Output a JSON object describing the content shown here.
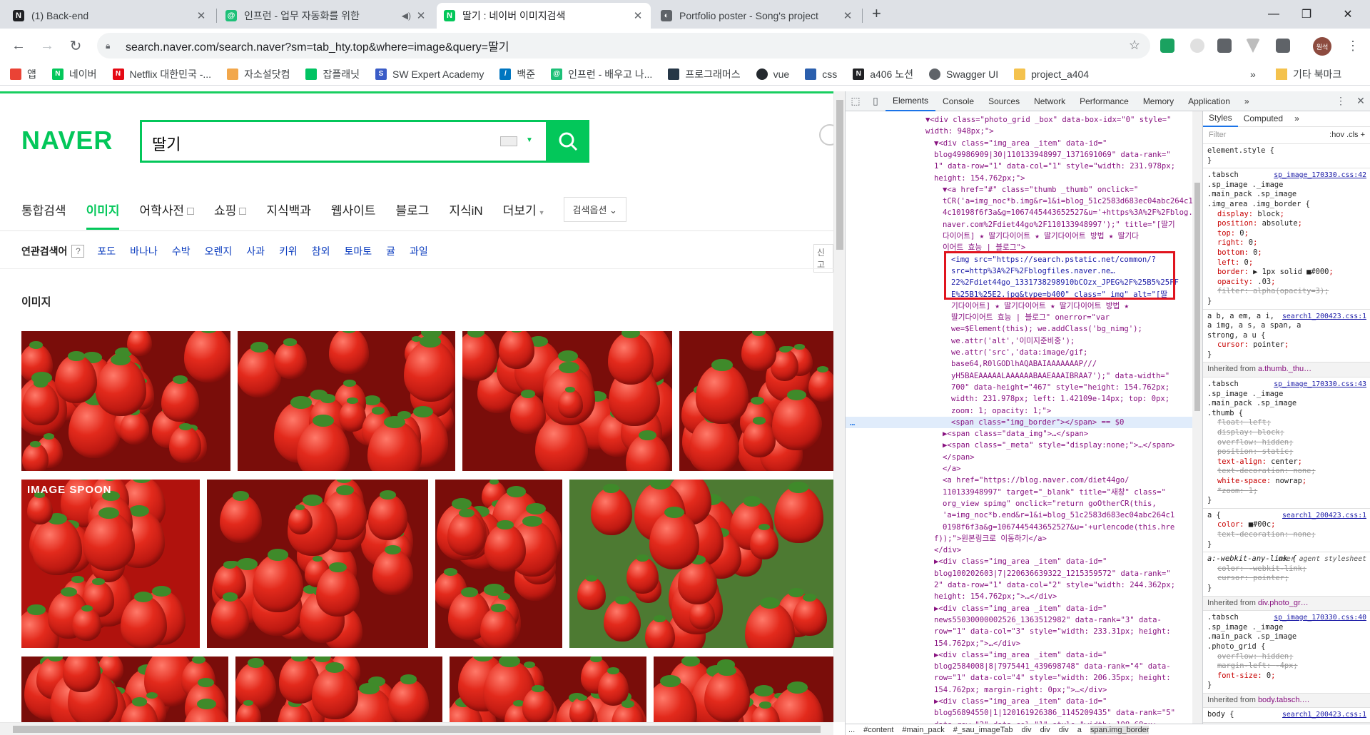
{
  "browser": {
    "tabs": [
      {
        "title": "(1) Back-end",
        "favicon_color": "#202124",
        "favicon_letter": "N"
      },
      {
        "title": "인프런 - 업무 자동화를 위한",
        "favicon_color": "#1dc078",
        "favicon_letter": "@"
      },
      {
        "title": "딸기 : 네이버 이미지검색",
        "favicon_color": "#03c75a",
        "favicon_letter": "N"
      },
      {
        "title": "Portfolio poster - Song's project",
        "favicon_color": "#5f6368",
        "favicon_letter": "◐"
      }
    ],
    "new_tab": "+",
    "window_controls": {
      "minimize": "—",
      "maximize": "❐",
      "close": "✕"
    },
    "url": "search.naver.com/search.naver?sm=tab_hty.top&where=image&query=딸기",
    "profile_label": "원석",
    "bookmarks": [
      {
        "label": "앱",
        "color": "#ea4335"
      },
      {
        "label": "네이버",
        "color": "#03c75a"
      },
      {
        "label": "Netflix 대한민국 -...",
        "color": "#e50914"
      },
      {
        "label": "자소설닷컴",
        "color": "#f2a74b"
      },
      {
        "label": "잡플래닛",
        "color": "#00c362"
      },
      {
        "label": "SW Expert Academy",
        "color": "#3a5cc7"
      },
      {
        "label": "백준",
        "color": "#0076c0"
      },
      {
        "label": "인프런 - 배우고 나...",
        "color": "#1dc078"
      },
      {
        "label": "프로그래머스",
        "color": "#263747"
      },
      {
        "label": "vue",
        "color": "#24292e"
      },
      {
        "label": "css",
        "color": "#2b5fad"
      },
      {
        "label": "a406 노션",
        "color": "#202124"
      },
      {
        "label": "Swagger UI",
        "color": "#5f6368"
      },
      {
        "label": "project_a404",
        "color": "#f4c24d"
      }
    ],
    "bookmarks_more": "»",
    "other_bookmarks": "기타 북마크"
  },
  "naver": {
    "logo": "NAVER",
    "query": "딸기",
    "tabs": [
      {
        "label": "통합검색",
        "active": false,
        "box": false
      },
      {
        "label": "이미지",
        "active": true,
        "box": false
      },
      {
        "label": "어학사전",
        "active": false,
        "box": true
      },
      {
        "label": "쇼핑",
        "active": false,
        "box": true
      },
      {
        "label": "지식백과",
        "active": false,
        "box": false
      },
      {
        "label": "웹사이트",
        "active": false,
        "box": false
      },
      {
        "label": "블로그",
        "active": false,
        "box": false
      },
      {
        "label": "지식iN",
        "active": false,
        "box": false
      },
      {
        "label": "더보기",
        "active": false,
        "box": false
      }
    ],
    "search_options": "검색옵션",
    "related_label": "연관검색어",
    "related_help": "?",
    "related_keywords": [
      "포도",
      "바나나",
      "수박",
      "오렌지",
      "사과",
      "키위",
      "참외",
      "토마토",
      "귤",
      "과일"
    ],
    "report": "신고",
    "image_section_title": "이미지",
    "thumb_label_spoon": "IMAGE SPOON"
  },
  "devtools": {
    "tabs": [
      "Elements",
      "Console",
      "Sources",
      "Network",
      "Performance",
      "Memory",
      "Application"
    ],
    "more": "»",
    "styles_tabs": [
      "Styles",
      "Computed"
    ],
    "filter_placeholder": "Filter",
    "hov": ":hov .cls +",
    "breadcrumb": [
      "...",
      "#content",
      "#main_pack",
      "#_sau_imageTab",
      "div",
      "div",
      "div",
      "a",
      "span.img_border"
    ],
    "dom_lines": [
      "▼<div class=\"photo_grid _box\" data-box-idx=\"0\" style=\"",
      "width: 948px;\">",
      "▼<div class=\"img_area _item\" data-id=\"",
      "blog49986909|30|110133948997_1371691069\" data-rank=\"",
      "1\" data-row=\"1\" data-col=\"1\" style=\"width: 231.978px;",
      "height: 154.762px;\">",
      "▼<a href=\"#\" class=\"thumb _thumb\" onclick=\"",
      "tCR('a=img_noc*b.img&r=1&i=blog_51c2583d683ec04abc264c1",
      "4c10198f6f3a&g=1067445443652527&u='+https%3A%2F%2Fblog.",
      "naver.com%2Fdiet44go%2F110133948997');\" title=\"[딸기",
      "다이어트] ★ 딸기다이어트 ★ 딸기다이어트 방법 ★ 딸기다",
      "이어트 효능 | 블로그\">",
      "<img src=\"https://search.pstatic.net/common/?",
      "src=http%3A%2F%2Fblogfiles.naver.ne…",
      "22%2Fdiet44go_1331738298910bCOzx_JPEG%2F%25B5%25FF",
      "E%25B1%25E2.jpg&type=b400\" class=\"_img\" alt=\"[딸",
      "기다이어트] ★ 딸기다이어트 ★ 딸기다이어트 방법 ★",
      "딸기다이어트 효능 | 블로그\" onerror=\"var",
      "we=$Element(this); we.addClass('bg_nimg');",
      "we.attr('alt','이미지준비중');",
      "we.attr('src','data:image/gif;",
      "base64,R0lGODlhAQABAIAAAAAAAP///",
      "yH5BAEAAAAALAAAAAABAAEAAAIBRAA7');\" data-width=\"",
      "700\" data-height=\"467\" style=\"height: 154.762px;",
      "width: 231.978px; left: 1.42109e-14px; top: 0px;",
      "zoom: 1; opacity: 1;\">",
      "<span class=\"img_border\"></span> == $0",
      "▶<span class=\"data_img\">…</span>",
      "▶<span class=\"_meta\" style=\"display:none;\">…</span>",
      "</span>",
      "</a>",
      "<a href=\"https://blog.naver.com/diet44go/",
      "110133948997\" target=\"_blank\" title=\"새창\" class=\"",
      "org_view spimg\" onclick=\"return goOtherCR(this,",
      "'a=img_noc*b.end&r=1&i=blog_51c2583d683ec04abc264c1",
      "0198f6f3a&g=1067445443652527&u='+urlencode(this.hre",
      "f));\">원본링크로 이동하기</a>",
      "</div>",
      "▶<div class=\"img_area _item\" data-id=\"",
      "blog100202603|7|220636639322_1215359572\" data-rank=\"",
      "2\" data-row=\"1\" data-col=\"2\" style=\"width: 244.362px;",
      "height: 154.762px;\">…</div>",
      "▶<div class=\"img_area _item\" data-id=\"",
      "news55030000002526_1363512982\" data-rank=\"3\" data-",
      "row=\"1\" data-col=\"3\" style=\"width: 233.31px; height:",
      "154.762px;\">…</div>",
      "▶<div class=\"img_area _item\" data-id=\"",
      "blog2584008|8|7975441_439698748\" data-rank=\"4\" data-",
      "row=\"1\" data-col=\"4\" style=\"width: 206.35px; height:",
      "154.762px; margin-right: 0px;\">…</div>",
      "▶<div class=\"img_area _item\" data-id=\"",
      "blog56894550|1|120161926386_1145209435\" data-rank=\"5\"",
      "data-row=\"2\" data-col=\"1\" style=\"width: 198.68px;"
    ],
    "styles": {
      "element_style": "element.style {",
      "rule1_selector": ".tabsch .sp_image ._image .main_pack .sp_image .img_area .img_border {",
      "rule1_source": "sp_image_170330.css:42",
      "rule1_props": [
        [
          "display",
          "block"
        ],
        [
          "position",
          "absolute"
        ],
        [
          "top",
          "0"
        ],
        [
          "right",
          "0"
        ],
        [
          "bottom",
          "0"
        ],
        [
          "left",
          "0"
        ],
        [
          "border",
          "▶ 1px solid ■#000"
        ],
        [
          "opacity",
          ".03"
        ]
      ],
      "rule1_struck": "filter: alpha(opacity=3);",
      "rule2_selector": "a b, a em, a i, a img, a s, a span, a strong, a u {",
      "rule2_source": "search1_200423.css:1",
      "rule2_prop": [
        "cursor",
        "pointer"
      ],
      "inherit1": "Inherited from",
      "inherit1_sel": "a.thumb._thu…",
      "rule3_selector": ".tabsch .sp_image ._image .main_pack .sp_image .thumb {",
      "rule3_source": "sp_image_170330.css:43",
      "rule3_props": [
        [
          "float",
          "left",
          true
        ],
        [
          "display",
          "block",
          true
        ],
        [
          "overflow",
          "hidden",
          true
        ],
        [
          "position",
          "static",
          true
        ],
        [
          "text-align",
          "center",
          false
        ],
        [
          "text-decoration",
          "none",
          true
        ],
        [
          "white-space",
          "nowrap",
          false
        ],
        [
          "*zoom",
          "1",
          true
        ]
      ],
      "rule4_selector": "a {",
      "rule4_source": "search1_200423.css:1",
      "rule4_props": [
        [
          "color",
          "■#00c"
        ],
        [
          "text-decoration",
          "none"
        ]
      ],
      "rule5_selector": "a:-webkit-any-link {",
      "rule5_source": "user agent stylesheet",
      "rule5_props": [
        [
          "color",
          "-webkit-link"
        ],
        [
          "cursor",
          "pointer"
        ]
      ],
      "inherit2": "Inherited from",
      "inherit2_sel": "div.photo_gr…",
      "rule6_selector": ".tabsch .sp_image ._image .main_pack .sp_image .photo_grid {",
      "rule6_source": "sp_image_170330.css:40",
      "rule6_props": [
        [
          "overflow",
          "hidden",
          true
        ],
        [
          "margin-left",
          "-4px",
          true
        ],
        [
          "font-size",
          "0",
          false
        ]
      ],
      "inherit3": "Inherited from",
      "inherit3_sel": "body.tabsch.…",
      "rule7_line": "body {",
      "rule7_source": "search1_200423.css:1"
    }
  }
}
